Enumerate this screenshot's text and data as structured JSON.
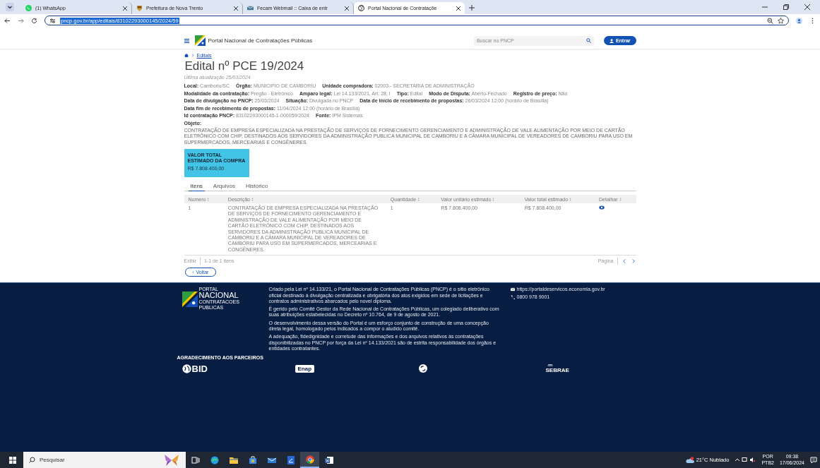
{
  "browser": {
    "tabs": [
      {
        "title": "(1) WhatsApp",
        "kind": "chat",
        "selected": false
      },
      {
        "title": "Prefeitura de Nova Trento",
        "kind": "crest",
        "selected": false
      },
      {
        "title": "Fecam Webmail :: Caixa de entr",
        "kind": "mail",
        "selected": false
      },
      {
        "title": "Portal Nacional de Contrataçõe",
        "kind": "globe",
        "selected": true
      }
    ],
    "address": "pncp.gov.br/app/editais/83102293000145/2024/59"
  },
  "header": {
    "title": "Portal Nacional de Contratações Públicas",
    "search_placeholder": "Buscar no PNCP",
    "login": "Entrar"
  },
  "breadcrumb": "Editais",
  "page_title": "Edital nº PCE 19/2024",
  "last_update": "Última atualização 25/03/2024",
  "fields": [
    [
      {
        "label": "Local:",
        "value": "Camboriu/SC"
      },
      {
        "label": "Órgão:",
        "value": "MUNICIPIO DE CAMBORIU"
      },
      {
        "label": "Unidade compradora:",
        "value": "02003 - SECRETARIA DE ADMINISTRAÇÃO"
      }
    ],
    [
      {
        "label": "Modalidade da contratação:",
        "value": "Pregão - Eletrônico"
      },
      {
        "label": "Amparo legal:",
        "value": "Lei 14.133/2021, Art. 28, I"
      },
      {
        "label": "Tipo:",
        "value": "Edital"
      },
      {
        "label": "Modo de Disputa:",
        "value": "Aberto-Fechado"
      },
      {
        "label": "Registro de preço:",
        "value": "Não"
      }
    ],
    [
      {
        "label": "Data de divulgação no PNCP:",
        "value": "25/03/2024"
      },
      {
        "label": "Situação:",
        "value": "Divulgada no PNCP"
      },
      {
        "label": "Data de início de recebimento de propostas:",
        "value": "26/03/2024 12:00 (horário de Brasília)"
      }
    ],
    [
      {
        "label": "Data fim de recebimento de propostas:",
        "value": "11/04/2024 12:00 (horário de Brasília)"
      }
    ],
    [
      {
        "label": "Id contratação PNCP:",
        "value": "83102293000145-1-000059/2024"
      },
      {
        "label": "Fonte:",
        "value": "IPM Sistemas"
      }
    ]
  ],
  "objeto_label": "Objeto:",
  "objeto": "CONTRATAÇÃO DE EMPRESA ESPECIALIZADA NA PRESTAÇÃO DE SERVIÇOS DE FORNECIMENTO GERENCIAMENTO E ADMINISTRAÇÃO DE VALE ALIMENTAÇÃO POR MEIO DE CARTÃO ELETRÔNICO COM CHIP, DESTINADOS AOS SERVIDORES DA ADMINISTRAÇÃO PUBLICA MUNICIPAL DE CAMBORIU E A CÂMARA MUNICIPAL DE VEREADORES DE CAMBORIU PARA USO EM SUPERMERCADOS, MERCEARIAS E CONGÊNERES.",
  "valor_box": {
    "label": "VALOR TOTAL ESTIMADO DA COMPRA",
    "value": "R$ 7.808.400,00"
  },
  "tabs": [
    {
      "label": "Itens",
      "selected": true
    },
    {
      "label": "Arquivos",
      "selected": false
    },
    {
      "label": "Histórico",
      "selected": false
    }
  ],
  "table": {
    "columns": [
      "Numero",
      "Descrição",
      "Quantidade",
      "Valor unitário estimado",
      "Valor total estimado",
      "Detalhar"
    ],
    "rows": [
      {
        "cells": [
          "1",
          "CONTRATAÇÃO DE EMPRESA ESPECIALIZADA NA PRESTAÇÃO DE SERVIÇOS DE FORNECIMENTO GERENCIAMENTO E ADMINISTRAÇÃO DE VALE ALIMENTAÇÃO POR MEIO DE CARTÃO ELETRÔNICO COM CHIP, DESTINADOS AOS SERVIDORES DA ADMINISTRAÇÃO PUBLICA MUNICIPAL DE CAMBORIU E A CÂMARA MUNICIPAL DE VEREADORES DE CAMBORIU PARA USO EM SUPERMERCADOS, MERCEARIAS E CONGÊNERES.",
          "1",
          "R$ 7.808.400,00",
          "R$ 7.808.400,00"
        ]
      }
    ]
  },
  "pagination": {
    "show_label": "Exibir",
    "range": "1-1 de 1 itens",
    "page_label": "Página"
  },
  "back_button": "Voltar",
  "footer": {
    "logo": [
      "PORTAL",
      "NACIONAL",
      "CONTRATACOES",
      "PUBLICAS"
    ],
    "paragraphs": [
      "Criado pela Lei nº 14.133/21, o Portal Nacional de Contratações Públicas (PNCP) é o sítio eletrônico oficial destinado à divulgação centralizada e obrigatória dos atos exigidos em sede de licitações e contratos administrativos abarcados pelo novel diploma.",
      "É gerido pelo Comitê Gestor da Rede Nacional de Contratações Públicas, um colegiado deliberativo com suas atribuições estabelecidas no Decreto nº 10.764, de 9 de agosto de 2021.",
      "O desenvolvimento dessa versão do Portal é um esforço conjunto de construção de uma concepção direta legal, homologado pelos indicados a compor o aludido comitê.",
      "A adequação, fidedignidade e corretude das informações e dos arquivos relativos às contratações disponibilizadas no PNCP por força da Lei nº 14.133/2021 são de estrita responsabilidade dos órgãos e entidades contratantes."
    ],
    "contacts": [
      {
        "kind": "mail",
        "text": "https://portaldeservicos.economia.gov.br"
      },
      {
        "kind": "phone",
        "text": "0800 978 9001"
      }
    ],
    "partners_title": "AGRADECIMENTO AOS PARCEIROS",
    "partners": [
      {
        "kind": "bid",
        "text": "BID"
      },
      {
        "kind": "enap",
        "text": "Enap"
      },
      {
        "kind": "swirl"
      },
      {
        "kind": "sebrae",
        "text": "SEBRAE"
      }
    ]
  },
  "taskbar": {
    "search_placeholder": "Pesquisar",
    "apps": [
      {
        "kind": "taskview",
        "active": false
      },
      {
        "kind": "edge",
        "active": false
      },
      {
        "kind": "folder",
        "active": false
      },
      {
        "kind": "store",
        "active": false
      },
      {
        "kind": "mail",
        "active": false
      },
      {
        "kind": "pdf",
        "active": false
      },
      {
        "kind": "chrome",
        "active": true
      },
      {
        "kind": "word",
        "active": false
      }
    ],
    "weather": "21°C Nublado",
    "language": [
      "POR",
      "PTB2"
    ],
    "clock": [
      "09:38",
      "17/06/2024"
    ]
  }
}
